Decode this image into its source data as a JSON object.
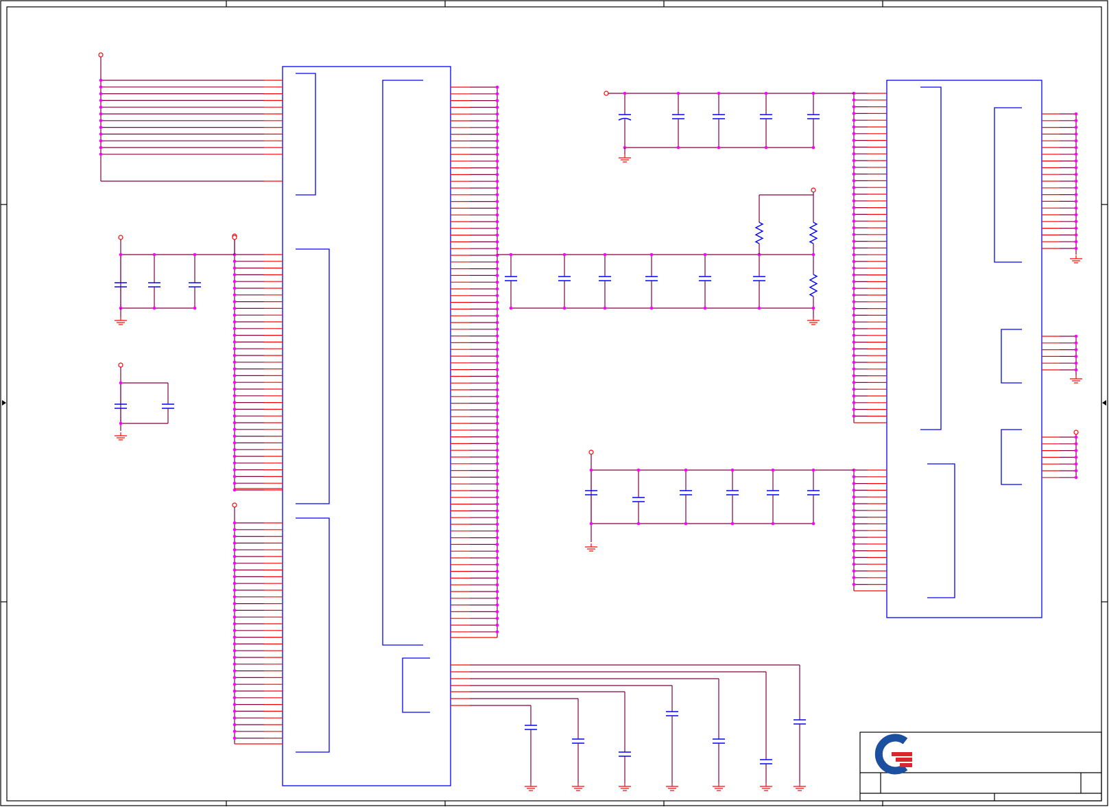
{
  "diagram": {
    "kind": "schematic-sheet",
    "colors": {
      "border": "#000000",
      "component_outline": "#0000ff",
      "wire": "#800040",
      "pin": "#ff0000",
      "junction": "#ff00ff",
      "power_symbol": "#ff0000",
      "logo_blue": "#1b4fa0",
      "logo_red": "#d9272e"
    },
    "symbols": {
      "left_bus_pins": 12,
      "main_chip_right_pins": 82,
      "right_chip_left_pins_upper": 49,
      "right_chip_left_pins_lower": 18,
      "decoupling_capacitors": 27,
      "resistors": 3,
      "ground_symbols": 17,
      "power_ports": 10
    },
    "title_block": {
      "logo": "company-logo"
    }
  }
}
